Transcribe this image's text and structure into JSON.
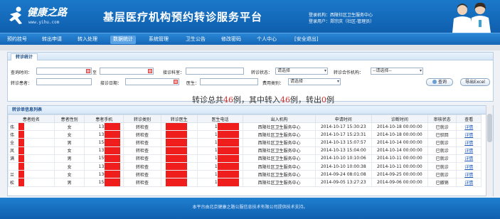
{
  "header": {
    "brand": "健康之路",
    "url": "www.yihu.com",
    "title": "基层医疗机构预约转诊服务平台",
    "login_org": "登录机构：西陵社区卫生服务中心",
    "login_user": "登录用户：郑宗庆（社区-管理员）"
  },
  "nav": {
    "items": [
      "预约挂号",
      "转出申请",
      "转入处理",
      "数据统计",
      "系统管理",
      "卫生公告",
      "修改密码",
      "个人中心",
      "[安全退出]"
    ],
    "active_index": 3
  },
  "filter": {
    "tab": "转诊统计",
    "query_time_label": "查询时间：",
    "to_label": "至",
    "accept_dept_label": "接诊科室：",
    "status_label": "转诊状态：",
    "status_value": "请选择",
    "partner_label": "转诊合作机构：",
    "partner_value": "--请选择--",
    "patient_label": "转诊患者：",
    "accept_date_label": "接诊日期：",
    "doctor_label": "医生：",
    "fee_type_label": "费用类别：",
    "fee_type_value": "请选择",
    "search_button": "查询",
    "export_button": "导出Excel"
  },
  "summary": {
    "prefix": "转诊总共",
    "total": "46",
    "mid1": "例，其中转入",
    "in_count": "46",
    "mid2": "例，转出",
    "out_count": "0",
    "suffix": "例"
  },
  "list": {
    "title": "转诊单信息列表",
    "columns": [
      "患者姓名",
      "患者性别",
      "患者手机",
      "转诊类别",
      "转诊医生",
      "医生电话",
      "出入机构",
      "申请时间",
      "诊断时间",
      "审核状态",
      "查看"
    ],
    "rows": [
      {
        "name": "伟",
        "gender": "女",
        "phone": "1320",
        "type": "转检查",
        "doctor": "",
        "dphone": "1388",
        "org": "西陵社区卫生服务中心",
        "apply": "2014-10-17 15:30:23",
        "diag": "2014-10-18 00:00:00",
        "status": "已就诊",
        "view": "详情"
      },
      {
        "name": "伟",
        "gender": "女",
        "phone": "1320",
        "type": "转检查",
        "doctor": "",
        "dphone": "1388",
        "org": "西陵社区卫生服务中心",
        "apply": "2014-10-17 15:23:31",
        "diag": "2014-10-18 00:00:00",
        "status": "已驳回",
        "view": "详情"
      },
      {
        "name": "全",
        "gender": "男",
        "phone": "1587",
        "type": "转检查",
        "doctor": "",
        "dphone": "1388",
        "org": "西陵社区卫生服务中心",
        "apply": "2014-10-13 15:07:57",
        "diag": "2014-10-14 00:00:00",
        "status": "已就诊",
        "view": "详情"
      },
      {
        "name": "凤",
        "gender": "女",
        "phone": "1338",
        "type": "转检查",
        "doctor": "",
        "dphone": "1388",
        "org": "西陵社区卫生服务中心",
        "apply": "2014-10-13 15:04:00",
        "diag": "2014-10-14 00:00:00",
        "status": "已就诊",
        "view": "详情"
      },
      {
        "name": "满",
        "gender": "男",
        "phone": "1597",
        "type": "转检查",
        "doctor": "",
        "dphone": "1587",
        "org": "西陵社区卫生服务中心",
        "apply": "2014-10-10 10:10:06",
        "diag": "2014-10-11 00:00:00",
        "status": "已就诊",
        "view": "详情"
      },
      {
        "name": "",
        "gender": "女",
        "phone": "1321",
        "type": "转检查",
        "doctor": "",
        "dphone": "1388",
        "org": "西陵社区卫生服务中心",
        "apply": "2014-10-10 10:00:38",
        "diag": "2014-10-11 00:00:00",
        "status": "已就诊",
        "view": "详情"
      },
      {
        "name": "兰",
        "gender": "女",
        "phone": "1304",
        "type": "转检查",
        "doctor": "",
        "dphone": "1388",
        "org": "西陵社区卫生服务中心",
        "apply": "2014-09-24 08:01:08",
        "diag": "2014-09-25 00:00:00",
        "status": "已就诊",
        "view": "详情"
      },
      {
        "name": "松",
        "gender": "男",
        "phone": "1587",
        "type": "转检查",
        "doctor": "",
        "dphone": "1587",
        "org": "西陵社区卫生服务中心",
        "apply": "2014-09-05 13:27:23",
        "diag": "2014-09-06 00:00:00",
        "status": "已撤销",
        "view": "详情"
      }
    ]
  },
  "footer": {
    "text": "本平台由北京健康之路公服信息技术有限公司提供技术支持。"
  },
  "colors": {
    "brand_blue": "#1566b6",
    "accent_red": "#d0302c",
    "redact_red": "#f01d1d"
  }
}
